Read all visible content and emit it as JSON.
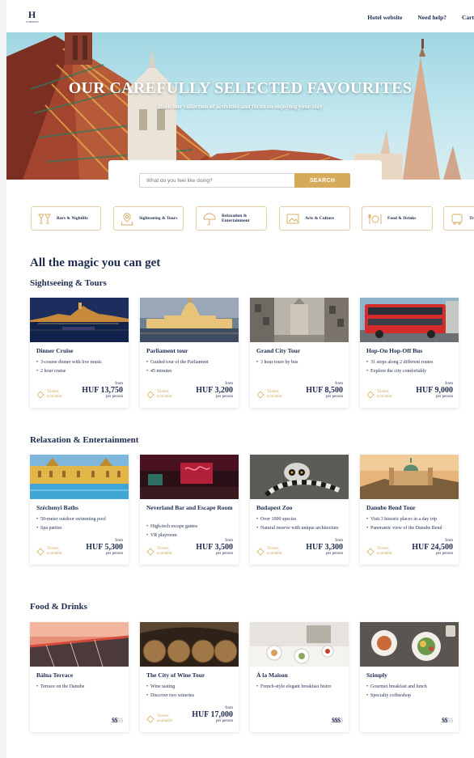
{
  "header": {
    "logo_mark": "H",
    "logo_text": "COMPANY",
    "nav": [
      "Hotel website",
      "Need help?",
      "Cart"
    ]
  },
  "hero": {
    "title": "OUR CAREFULLY SELECTED FAVOURITES",
    "subtitle": "Book our collection of activities and focus on enjoying your stay"
  },
  "search": {
    "placeholder": "What do you feel like doing?",
    "button": "SEARCH"
  },
  "categories": [
    {
      "label": "Bars & Nightlife",
      "icon": "cocktail-glasses-icon"
    },
    {
      "label": "Sightseeing & Tours",
      "icon": "map-pin-icon"
    },
    {
      "label": "Relaxation & Entertainment",
      "icon": "umbrella-icon"
    },
    {
      "label": "Arts & Culture",
      "icon": "picture-frame-icon"
    },
    {
      "label": "Food & Drinks",
      "icon": "plate-cutlery-icon"
    },
    {
      "label": "Tr",
      "icon": "transport-icon"
    }
  ],
  "main_title": "All the magic you can get",
  "sections": [
    {
      "title": "Sightseeing & Tours",
      "cards": [
        {
          "title": "Dinner Cruise",
          "bullets": [
            "3-course dinner with live music",
            "2 hour cruise"
          ],
          "tickets": "Tickets available!",
          "from": "from",
          "price": "HUF 13,750",
          "per": "per person"
        },
        {
          "title": "Parliament tour",
          "bullets": [
            "Guided tour of the Parliament",
            "45 minutes"
          ],
          "tickets": "Tickets available!",
          "from": "from",
          "price": "HUF 3,200",
          "per": "per person"
        },
        {
          "title": "Grand City Tour",
          "bullets": [
            "3 hour tours by bus"
          ],
          "tickets": "Tickets available!",
          "from": "from",
          "price": "HUF 8,500",
          "per": "per person"
        },
        {
          "title": "Hop-On Hop-Off Bus",
          "bullets": [
            "31 stops along 2 different routes",
            "Explore the city comfortably"
          ],
          "tickets": "Tickets available!",
          "from": "from",
          "price": "HUF 9,000",
          "per": "per person"
        }
      ]
    },
    {
      "title": "Relaxation & Entertainment",
      "cards": [
        {
          "title": "Széchenyi Baths",
          "bullets": [
            "50-meter outdoor swimming pool",
            "Spa parties"
          ],
          "tickets": "Tickets available!",
          "from": "from",
          "price": "HUF 5,300",
          "per": "per person"
        },
        {
          "title": "Neverland Bar and Escape Room",
          "bullets": [
            "High-tech escape games",
            "VR playroom"
          ],
          "tickets": "Tickets available!",
          "from": "from",
          "price": "HUF 3,500",
          "per": "per person"
        },
        {
          "title": "Budapest Zoo",
          "bullets": [
            "Over 1000 species",
            "Natural reserve with unique architecture"
          ],
          "tickets": "Tickets available!",
          "from": "from",
          "price": "HUF 3,300",
          "per": "per person"
        },
        {
          "title": "Danube Bend Tour",
          "bullets": [
            "Visit 3 historic places in a day trip",
            "Panoramic view of the Danube Bend"
          ],
          "tickets": "Tickets available!",
          "from": "from",
          "price": "HUF 24,500",
          "per": "per person"
        }
      ]
    },
    {
      "title": "Food & Drinks",
      "cards": [
        {
          "title": "Bálna Terrace",
          "bullets": [
            "Terrace on the Danube"
          ],
          "price_level": 2
        },
        {
          "title": "The City of Wine Tour",
          "bullets": [
            "Wine tasting",
            "Discover two wineries"
          ],
          "tickets": "Tickets available!",
          "from": "from",
          "price": "HUF 17,000",
          "per": "per person"
        },
        {
          "title": "Á la Maison",
          "bullets": [
            "French-style elegant breakfast bistro"
          ],
          "price_level": 3
        },
        {
          "title": "Szimply",
          "bullets": [
            "Gourmet breakfast and lunch",
            "Specialty coffeeshop"
          ],
          "price_level": 2
        }
      ]
    }
  ],
  "colors": {
    "navy": "#1d2b4f",
    "gold": "#d5aa5b",
    "muted": "#c8ccd4"
  }
}
